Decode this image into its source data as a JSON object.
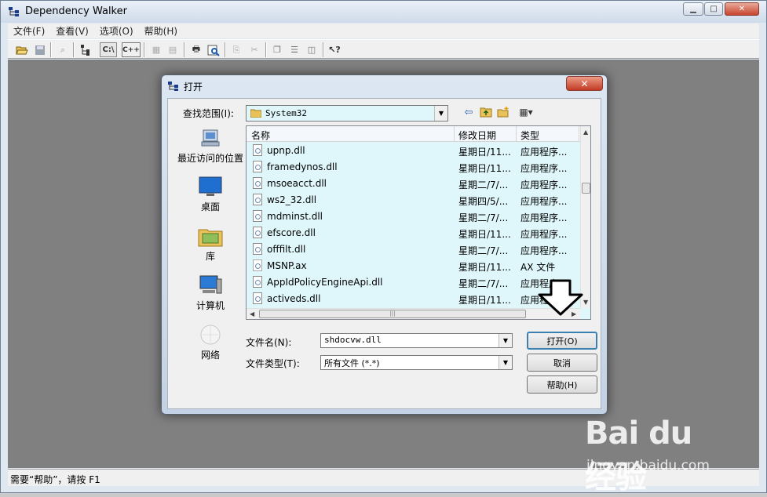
{
  "window": {
    "title": "Dependency Walker",
    "controls": [
      "minimize",
      "maximize",
      "close"
    ]
  },
  "menu": [
    "文件(F)",
    "查看(V)",
    "选项(O)",
    "帮助(H)"
  ],
  "toolbar": {
    "buttons": [
      "open-icon",
      "save-icon",
      "find-icon",
      "module-tree-icon",
      "full-paths-icon",
      "undecorate-cpp-icon",
      "properties-icon",
      "external-viewer-icon",
      "print-icon",
      "quick-view-icon",
      "copy-icon",
      "help-icon"
    ],
    "full_paths_label": "C:\\",
    "cpp_label": "C++"
  },
  "status": {
    "text": "需要“帮助”，请按 F1"
  },
  "dialog": {
    "title": "打开",
    "lookin_label": "查找范围(I):",
    "lookin_value": "System32",
    "places": [
      {
        "label": "最近访问的位置",
        "icon": "recent-places-icon"
      },
      {
        "label": "桌面",
        "icon": "desktop-icon"
      },
      {
        "label": "库",
        "icon": "libraries-icon"
      },
      {
        "label": "计算机",
        "icon": "computer-icon"
      },
      {
        "label": "网络",
        "icon": "network-icon"
      }
    ],
    "columns": [
      "名称",
      "修改日期",
      "类型"
    ],
    "files": [
      {
        "name": "upnp.dll",
        "date": "星期日/11...",
        "type": "应用程序..."
      },
      {
        "name": "framedynos.dll",
        "date": "星期日/11...",
        "type": "应用程序..."
      },
      {
        "name": "msoeacct.dll",
        "date": "星期二/7/...",
        "type": "应用程序..."
      },
      {
        "name": "ws2_32.dll",
        "date": "星期四/5/...",
        "type": "应用程序..."
      },
      {
        "name": "mdminst.dll",
        "date": "星期二/7/...",
        "type": "应用程序..."
      },
      {
        "name": "efscore.dll",
        "date": "星期日/11...",
        "type": "应用程序..."
      },
      {
        "name": "offfilt.dll",
        "date": "星期二/7/...",
        "type": "应用程序..."
      },
      {
        "name": "MSNP.ax",
        "date": "星期日/11...",
        "type": "AX 文件"
      },
      {
        "name": "AppIdPolicyEngineApi.dll",
        "date": "星期二/7/...",
        "type": "应用程序..."
      },
      {
        "name": "activeds.dll",
        "date": "星期日/11...",
        "type": "应用程序..."
      }
    ],
    "filename_label": "文件名(N):",
    "filename_value": "shdocvw.dll",
    "filetype_label": "文件类型(T):",
    "filetype_value": "所有文件 (*.*)",
    "open_button": "打开(O)",
    "cancel_button": "取消",
    "help_button": "帮助(H)"
  },
  "watermark": {
    "logo": "Bai du 经验",
    "url": "jingyan.baidu.com"
  },
  "colors": {
    "selection_bg": "#dff7fb",
    "workspace": "#808080",
    "titlebar": "#cfdbea"
  }
}
